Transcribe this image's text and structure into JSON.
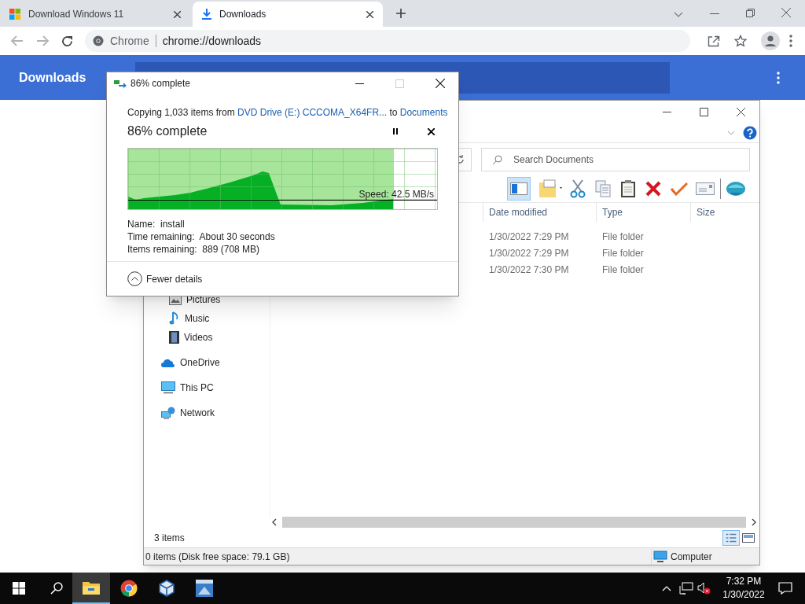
{
  "browser": {
    "tabs": [
      {
        "title": "Download Windows 11",
        "kind": "windows",
        "selected": false
      },
      {
        "title": "Downloads",
        "kind": "download",
        "selected": true
      }
    ],
    "omnibox": {
      "origin": "Chrome",
      "url": "chrome://downloads"
    }
  },
  "downloads_page": {
    "title": "Downloads"
  },
  "explorer": {
    "search": {
      "placeholder": "Search Documents"
    },
    "columns": [
      "Date modified",
      "Type",
      "Size"
    ],
    "rows": [
      {
        "date_modified": "1/30/2022 7:29 PM",
        "type": "File folder"
      },
      {
        "date_modified": "1/30/2022 7:29 PM",
        "type": "File folder"
      },
      {
        "date_modified": "1/30/2022 7:30 PM",
        "type": "File folder"
      }
    ],
    "quick_access": [
      {
        "label": "Pictures",
        "kind": "pictures"
      },
      {
        "label": "Music",
        "kind": "music"
      },
      {
        "label": "Videos",
        "kind": "videos"
      }
    ],
    "locations": [
      {
        "label": "OneDrive",
        "kind": "onedrive"
      },
      {
        "label": "This PC",
        "kind": "pc"
      },
      {
        "label": "Network",
        "kind": "network"
      }
    ],
    "item_count": "3 items",
    "status": "0 items (Disk free space: 79.1 GB)",
    "status_location": "Computer"
  },
  "copy_dialog": {
    "title": "86% complete",
    "message": {
      "prefix": "Copying 1,033 items from",
      "source": "DVD Drive (E:) CCCOMA_X64FR...",
      "middle": "to",
      "destination": "Documents"
    },
    "heading": "86% complete",
    "level": 0.86,
    "speed": "Speed: 42.5 MB/s",
    "details": [
      "Name:  install",
      "Time remaining:  About 30 seconds",
      "Items remaining:  889 (708 MB)"
    ],
    "toggle": "Fewer details"
  },
  "taskbar": {
    "apps": [
      {
        "kind": "explorer",
        "selected": true
      },
      {
        "kind": "chrome",
        "selected": false
      },
      {
        "kind": "virtualbox",
        "selected": false
      },
      {
        "kind": "app",
        "selected": false
      }
    ],
    "time": "7:32 PM",
    "date": "1/30/2022"
  }
}
